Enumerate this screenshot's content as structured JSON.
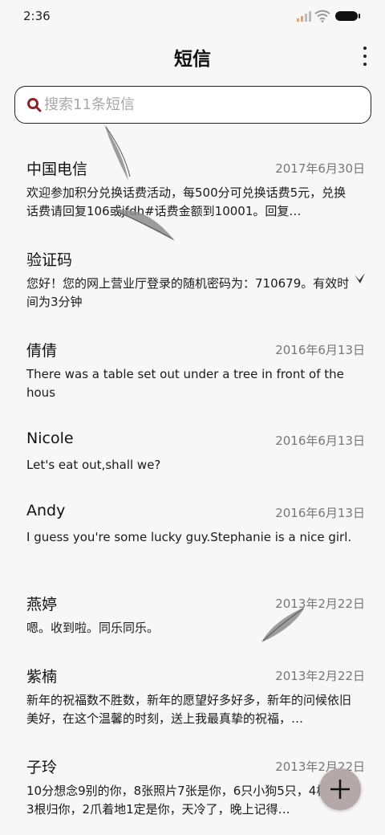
{
  "status_bar": {
    "time": "2:36"
  },
  "header": {
    "title": "短信"
  },
  "search": {
    "placeholder": "搜索11条短信"
  },
  "messages": [
    {
      "name": "中国电信",
      "date": "2017年6月30日",
      "preview": "欢迎参加积分兑换话费活动，每500分可兑换话费5元，兑换话费请回复106或jfdh#话费金额到10001。回复…"
    },
    {
      "name": "验证码",
      "date": "",
      "preview": "您好！您的网上营业厅登录的随机密码为：710679。有效时间为3分钟"
    },
    {
      "name": "倩倩",
      "date": "2016年6月13日",
      "preview": "There was a table set out under a tree in front of the hous"
    },
    {
      "name": "Nicole",
      "date": "2016年6月13日",
      "preview": "Let's eat out,shall we?"
    },
    {
      "name": "Andy",
      "date": "2016年6月13日",
      "preview": "I guess you're some lucky guy.Stephanie is a nice girl."
    },
    {
      "name": "燕婷",
      "date": "2013年2月22日",
      "preview": "嗯。收到啦。同乐同乐。"
    },
    {
      "name": "紫楠",
      "date": "2013年2月22日",
      "preview": "新年的祝福数不胜数，新年的愿望好多好多，新年的问候依旧美好，在这个温馨的时刻，送上我最真挚的祝福，…"
    },
    {
      "name": "子玲",
      "date": "2013年2月22日",
      "preview": "10分想念9别的你，8张照片7张是你，6只小狗5只，4根骨头3根归你，2爪着地1定是你，天冷了，晚上记得…"
    }
  ]
}
